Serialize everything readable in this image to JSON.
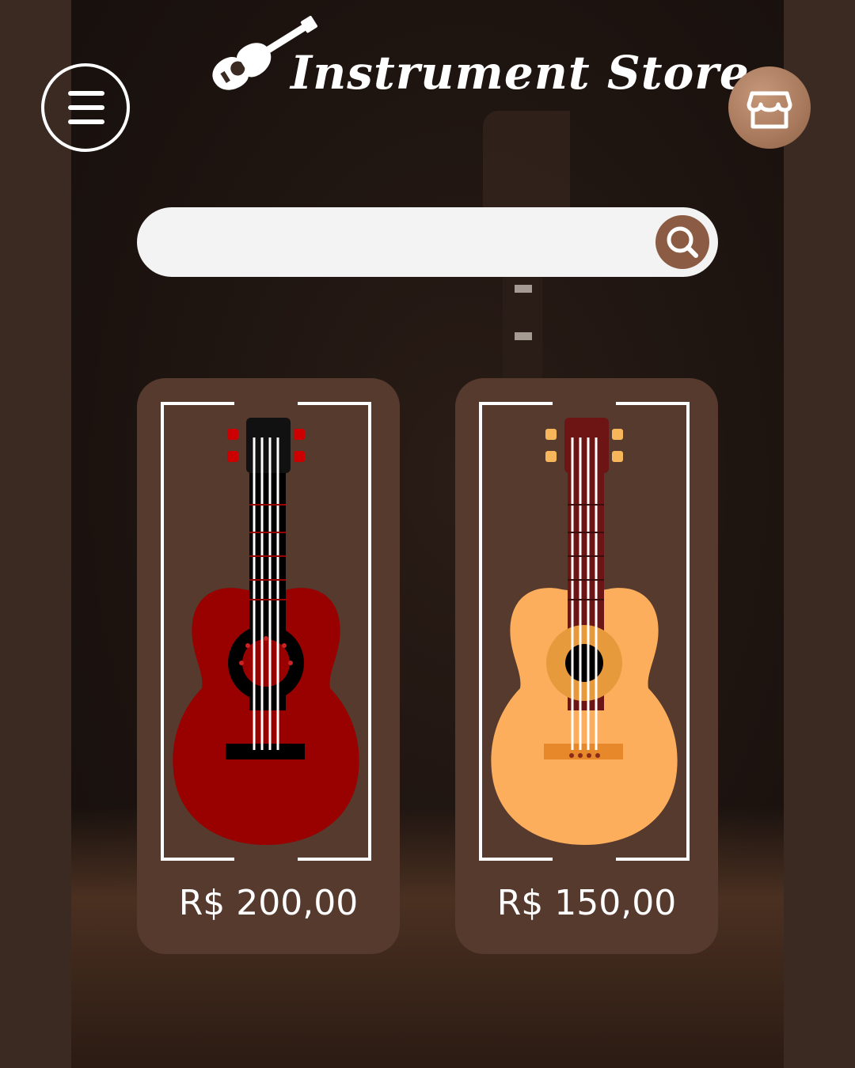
{
  "header": {
    "title": "Instrument Store",
    "menu_icon": "hamburger-menu-icon",
    "store_icon": "storefront-icon",
    "logo_icon": "guitar-logo-icon"
  },
  "search": {
    "placeholder": "",
    "value": "",
    "icon": "search-icon"
  },
  "products": [
    {
      "name": "red acoustic guitar",
      "price": "R$ 200,00",
      "body_color": "#990000"
    },
    {
      "name": "orange acoustic guitar",
      "price": "R$ 150,00",
      "body_color": "#fdae5c"
    }
  ],
  "colors": {
    "background": "#1f1511",
    "card": "#553a2d",
    "accent": "#8c5b43",
    "text": "#ffffff"
  }
}
